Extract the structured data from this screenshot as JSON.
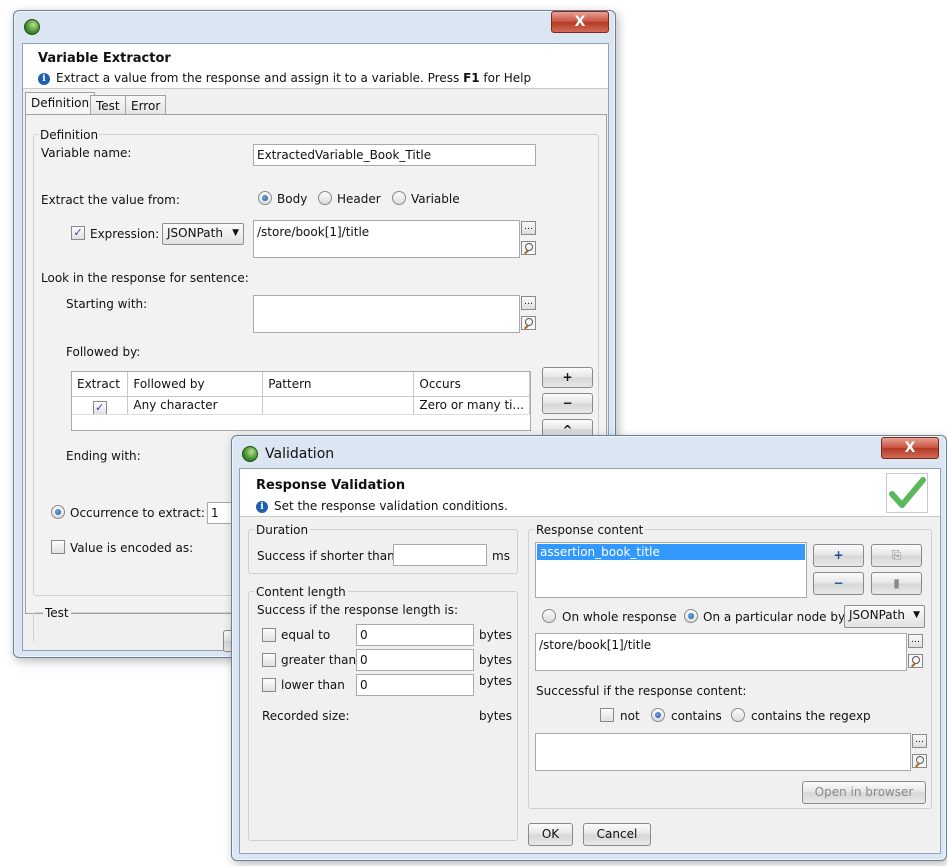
{
  "extractor": {
    "close": "X",
    "header_title": "Variable Extractor",
    "header_info_pre": "Extract a value from the response and assign it to a variable. Press ",
    "header_info_key": "F1",
    "header_info_post": " for Help",
    "tabs": [
      {
        "label": "Definition"
      },
      {
        "label": "Test"
      },
      {
        "label": "Error"
      }
    ],
    "group_label": "Definition",
    "variable_name_label": "Variable name:",
    "variable_name_value": "ExtractedVariable_Book_Title",
    "extract_from_label": "Extract the value from:",
    "source_options": [
      {
        "label": "Body"
      },
      {
        "label": "Header"
      },
      {
        "label": "Variable"
      }
    ],
    "expression_label": "Expression:",
    "expression_type": "JSONPath",
    "expression_value": "/store/book[1]/title",
    "look_label": "Look in the response for sentence:",
    "starting_with_label": "Starting with:",
    "followed_by_label": "Followed by:",
    "table_headers": [
      "Extract",
      "Followed by",
      "Pattern",
      "Occurs"
    ],
    "table_row": {
      "followed_by": "Any character",
      "pattern": "",
      "occurs": "Zero or many ti..."
    },
    "side_buttons": [
      "+",
      "−",
      "^"
    ],
    "ending_with_label": "Ending with:",
    "occurrence_label": "Occurrence to extract:",
    "occurrence_value": "1",
    "encoded_label": "Value is encoded as:",
    "test_label": "Test"
  },
  "validation": {
    "title": "Validation",
    "close": "X",
    "header_title": "Response Validation",
    "header_info": "Set the response validation conditions.",
    "duration": {
      "label": "Duration",
      "success_label": "Success if shorter than",
      "value": "",
      "unit": "ms"
    },
    "content_length": {
      "label": "Content length",
      "success_label": "Success if the response length is:",
      "rows": [
        {
          "label": "equal to",
          "value": "0",
          "unit": "bytes"
        },
        {
          "label": "greater than",
          "value": "0",
          "unit": "bytes"
        },
        {
          "label": "lower than",
          "value": "0",
          "unit": "bytes"
        }
      ],
      "recorded_label": "Recorded size:",
      "recorded_unit": "bytes"
    },
    "response_content": {
      "label": "Response content",
      "list_items": [
        {
          "label": "assertion_book_title"
        }
      ],
      "add": "+",
      "remove": "−",
      "whole_label": "On whole response",
      "node_label": "On a particular node by",
      "node_type": "JSONPath",
      "path_value": "/store/book[1]/title",
      "successful_label": "Successful if the response content:",
      "not_label": "not",
      "contains_label": "contains",
      "regexp_label": "contains the regexp",
      "regex_value": "",
      "open_browser": "Open in browser"
    },
    "ok": "OK",
    "cancel": "Cancel"
  },
  "colors": {
    "selection": "#3399ff",
    "accent_check": "#5cb85c"
  }
}
